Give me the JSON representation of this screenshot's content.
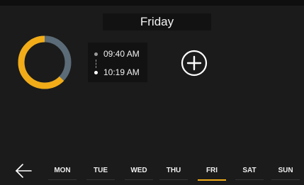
{
  "header": {
    "day_title": "Friday"
  },
  "schedule": {
    "start_time": "09:40 AM",
    "end_time": "10:19 AM"
  },
  "controls": {
    "add_icon": "plus-circle-icon",
    "back_icon": "arrow-left-icon"
  },
  "days": {
    "items": [
      {
        "label": "MON",
        "selected": false
      },
      {
        "label": "TUE",
        "selected": false
      },
      {
        "label": "WED",
        "selected": false
      },
      {
        "label": "THU",
        "selected": false
      },
      {
        "label": "FRI",
        "selected": true
      },
      {
        "label": "SAT",
        "selected": false
      },
      {
        "label": "SUN",
        "selected": false
      }
    ]
  },
  "colors": {
    "background": "#1b1b1b",
    "panel": "#121212",
    "accent": "#f2ac18",
    "ring_inactive": "#5b6b77",
    "text": "#f2f2f2"
  }
}
